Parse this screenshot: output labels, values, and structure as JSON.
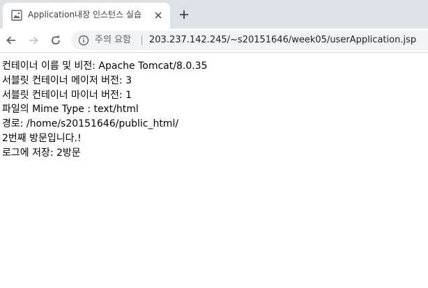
{
  "browser": {
    "tab": {
      "title": "Application내장 인스턴스 실습",
      "favicon_icon": "image-favicon-icon",
      "close_icon": "close-icon"
    },
    "new_tab_icon": "plus-icon",
    "nav": {
      "back_icon": "arrow-left-icon",
      "forward_icon": "arrow-right-icon",
      "reload_icon": "reload-icon"
    },
    "address_bar": {
      "security_icon": "info-icon",
      "security_label": "주의 요함",
      "url": "203.237.142.245/~s20151646/week05/userApplication.jsp"
    }
  },
  "page": {
    "lines": [
      "컨테이너 이름 및 비전: Apache Tomcat/8.0.35",
      "서블릿 컨테이너 메이저 버전: 3",
      "서블릿 컨테이너 마이너 버전: 1",
      "파일의 Mime Type : text/html",
      "경로: /home/s20151646/public_html/",
      "2번째 방문입니다.!",
      "로그에 저장: 2방문"
    ]
  },
  "colors": {
    "tabstrip_bg": "#dee1e6",
    "omnibox_bg": "#f1f3f4",
    "text": "#000000",
    "muted": "#5f6368"
  }
}
